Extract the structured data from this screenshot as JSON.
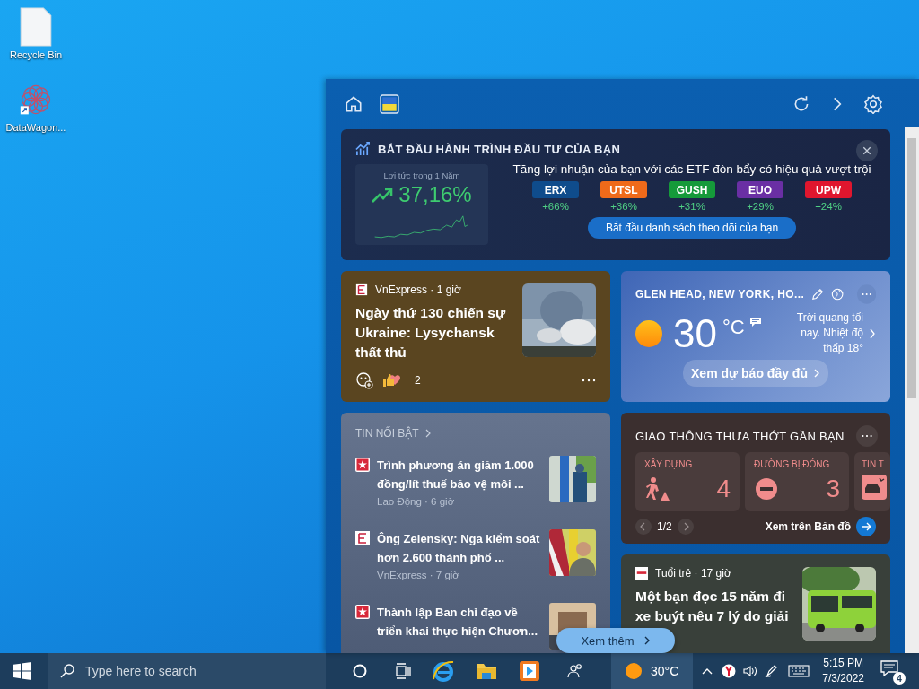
{
  "desktop_icons": [
    {
      "label": "Recycle Bin",
      "kind": "file"
    },
    {
      "label": "DataWagon...",
      "kind": "app"
    }
  ],
  "invest_banner": {
    "title": "BẮT ĐẦU HÀNH TRÌNH ĐẦU TƯ CỦA BẠN",
    "return_label": "Lợi tức trong 1 Năm",
    "return_value": "37,16%",
    "headline": "Tăng lợi nhuận của bạn với các ETF đòn bẩy có hiệu quả vượt trội",
    "etfs": [
      {
        "ticker": "ERX",
        "change": "+66%",
        "color": "#0f4c8c"
      },
      {
        "ticker": "UTSL",
        "change": "+36%",
        "color": "#ef6a1a"
      },
      {
        "ticker": "GUSH",
        "change": "+31%",
        "color": "#159a3a"
      },
      {
        "ticker": "EUO",
        "change": "+29%",
        "color": "#6a2fa4"
      },
      {
        "ticker": "UPW",
        "change": "+24%",
        "color": "#e0162e"
      }
    ],
    "button": "Bắt đầu danh sách theo dõi của bạn"
  },
  "news_card": {
    "source": "VnExpress · 1 giờ",
    "headline": "Ngày thứ 130 chiến sự Ukraine: Lysychansk thất thủ",
    "reactions": "2"
  },
  "weather": {
    "location": "GLEN HEAD, NEW YORK, HO...",
    "temperature": "30",
    "unit": "°C",
    "summary": "Trời quang tối nay. Nhiệt độ thấp 18°",
    "button": "Xem dự báo đầy đủ"
  },
  "top_stories": {
    "title": "TIN NỐI BẬT",
    "items": [
      {
        "kind": "laodong",
        "headline": "Trình phương án giảm 1.000 đồng/lít thuế bảo vệ môi ...",
        "source": "Lao Động · 6 giờ"
      },
      {
        "kind": "vnexpress",
        "headline": "Ông Zelensky: Nga kiểm soát hơn 2.600 thành phố ...",
        "source": "VnExpress · 7 giờ"
      },
      {
        "kind": "laodong",
        "headline": "Thành lập Ban chỉ đạo về triển khai thực hiện Chươn..."
      }
    ]
  },
  "traffic": {
    "title": "GIAO THÔNG THƯA THỚT GẦN BẠN",
    "tiles": [
      {
        "kind": "construction",
        "label": "XÂY DỰNG",
        "count": "4"
      },
      {
        "kind": "closed",
        "label": "ĐƯỜNG BỊ ĐÓNG",
        "count": "3"
      },
      {
        "kind": "incident",
        "label": "TIN T"
      }
    ],
    "page": "1/2",
    "map_link": "Xem trên Bản đồ"
  },
  "story_card": {
    "source": "Tuổi trẻ · 17 giờ",
    "headline": "Một bạn đọc 15 năm đi xe buýt nêu 7 lý do giải"
  },
  "more_button": "Xem thêm",
  "taskbar": {
    "search_placeholder": "Type here to search",
    "weather": "30°C",
    "time": "5:15 PM",
    "date": "7/3/2022",
    "notifications": "4"
  }
}
